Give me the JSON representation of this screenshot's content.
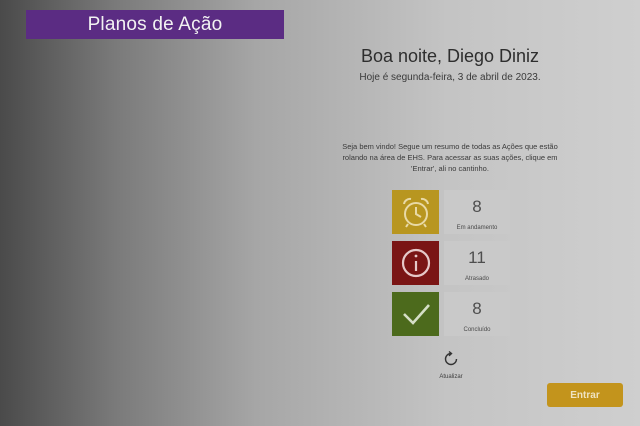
{
  "header": {
    "title": "Planos de Ação"
  },
  "greeting": {
    "text": "Boa noite, Diego Diniz",
    "date": "Hoje é segunda-feira, 3 de abril de 2023."
  },
  "intro": {
    "text": "Seja bem vindo! Segue um resumo de todas as Ações que estão rolando na área de EHS. Para acessar as suas ações, clique em 'Entrar', ali no cantinho."
  },
  "stats": [
    {
      "icon": "alarm-clock-icon",
      "count": "8",
      "label": "Em andamento",
      "color": "#b89620"
    },
    {
      "icon": "info-circle-icon",
      "count": "11",
      "label": "Atrasado",
      "color": "#7a1515"
    },
    {
      "icon": "checkmark-icon",
      "count": "8",
      "label": "Concluído",
      "color": "#4c6a1c"
    }
  ],
  "refresh": {
    "icon": "refresh-icon",
    "label": "Atualizar"
  },
  "actions": {
    "enter_label": "Entrar"
  },
  "colors": {
    "title_bar": "#5b2c83",
    "enter_button": "#c3941c"
  }
}
